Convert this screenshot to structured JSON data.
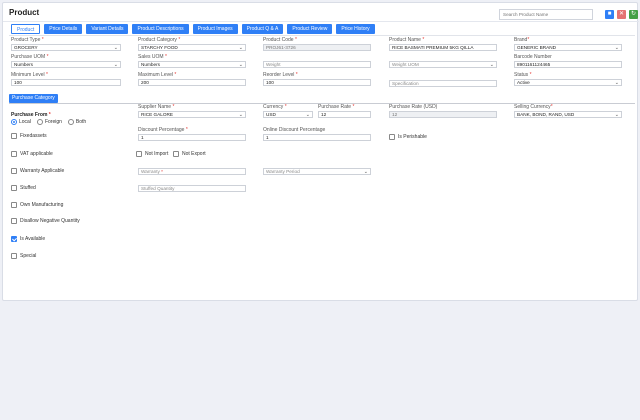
{
  "page_title": "Product",
  "search": {
    "placeholder": "Search Product Name"
  },
  "header_icons": [
    {
      "name": "save-icon",
      "color": "#2f7ff6"
    },
    {
      "name": "delete-icon",
      "color": "#e57373"
    },
    {
      "name": "refresh-icon",
      "color": "#43a047"
    }
  ],
  "tabs": [
    "Product",
    "Price Details",
    "Variant Details",
    "Product Descriptions",
    "Product Images",
    "Product Q & A",
    "Product Review",
    "Price History"
  ],
  "active_tab": "Product",
  "fields": {
    "product_type": {
      "label": "Product Type",
      "value": "GROCERY"
    },
    "product_category": {
      "label": "Product Category",
      "value": "STARCHY FOOD"
    },
    "product_code": {
      "label": "Product Code",
      "value": "PROJ61-3726"
    },
    "product_name": {
      "label": "Product Name",
      "value": "RICE BASMATI PREMIUM 5KG QILLA"
    },
    "brand": {
      "label": "Brand",
      "value": "GENERIC BRAND"
    },
    "purchase_uom": {
      "label": "Purchase UOM",
      "value": "Numbers"
    },
    "sales_uom": {
      "label": "Sales UOM",
      "value": "Numbers"
    },
    "weight": {
      "placeholder": "Weight"
    },
    "weight_uom": {
      "placeholder": "Weight UOM"
    },
    "barcode_number": {
      "label": "Barcode Number",
      "value": "8901161124465"
    },
    "minimum_level": {
      "label": "Minimum Level",
      "value": "100"
    },
    "maximum_level": {
      "label": "Maximum Level",
      "value": "200"
    },
    "reorder_level": {
      "label": "Reorder Level",
      "value": "100"
    },
    "specification": {
      "placeholder": "Specification"
    },
    "status": {
      "label": "Status",
      "value": "Active"
    },
    "supplier_name": {
      "label": "Supplier Name",
      "value": "RICE GALORE"
    },
    "currency": {
      "label": "Currency",
      "value": "USD"
    },
    "purchase_rate": {
      "label": "Purchase Rate",
      "value": "12"
    },
    "purchase_rate_usd": {
      "label": "Purchase Rate (USD)",
      "value": "12"
    },
    "selling_currency": {
      "label": "Selling Currency",
      "value": "BANK, BOND, RAND, USD"
    },
    "discount_percentage": {
      "label": "Discount Percentage",
      "value": "1"
    },
    "online_discount_percentage": {
      "label": "Online Discount Percentage",
      "value": "1"
    },
    "warranty": {
      "placeholder": "Warranty"
    },
    "warranty_period": {
      "placeholder": "Warranty Period"
    },
    "stuffed_quantity": {
      "placeholder": "Stuffed Quantity"
    }
  },
  "section_button": "Purchase Category",
  "purchase_from": {
    "label": "Purchase From",
    "options": [
      "Local",
      "Foreign",
      "Both"
    ],
    "selected": "Local"
  },
  "checkboxes": {
    "fixedassets": {
      "label": "Fixedassets",
      "checked": false
    },
    "is_perishable": {
      "label": "Is Perishable",
      "checked": false
    },
    "vat_applicable": {
      "label": "VAT applicable",
      "checked": false
    },
    "not_import": {
      "label": "Not Import",
      "checked": false
    },
    "not_export": {
      "label": "Not Export",
      "checked": false
    },
    "warranty_applicable": {
      "label": "Warranty Applicable",
      "checked": false
    },
    "stuffed": {
      "label": "Stuffed",
      "checked": false
    },
    "own_manufacturing": {
      "label": "Own Manufacturing",
      "checked": false
    },
    "disallow_negative_quantity": {
      "label": "Disallow Negative Quantity",
      "checked": false
    },
    "is_available": {
      "label": "Is Available",
      "checked": true
    },
    "special": {
      "label": "Special",
      "checked": false
    }
  }
}
